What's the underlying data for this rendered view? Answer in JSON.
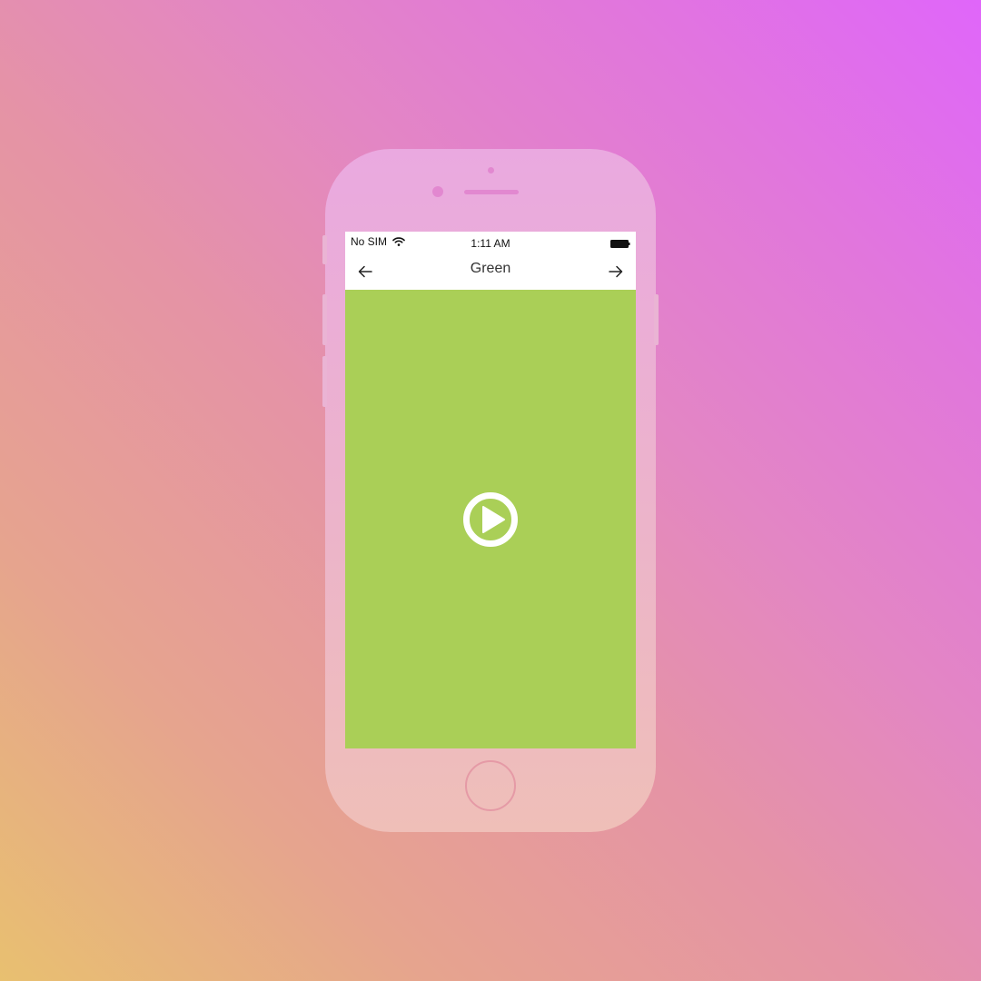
{
  "status_bar": {
    "carrier": "No SIM",
    "time": "1:11 AM",
    "wifi_icon": "wifi-icon",
    "battery_icon": "battery-full-icon"
  },
  "nav_bar": {
    "title": "Green",
    "back_icon": "arrow-left-icon",
    "forward_icon": "arrow-right-icon"
  },
  "content": {
    "background_color": "#aacf57",
    "play_icon": "play-circle-icon"
  },
  "colors": {
    "phone_body": "#ecb4ca",
    "screen_header": "#ffffff",
    "icon_color": "#ffffff"
  }
}
